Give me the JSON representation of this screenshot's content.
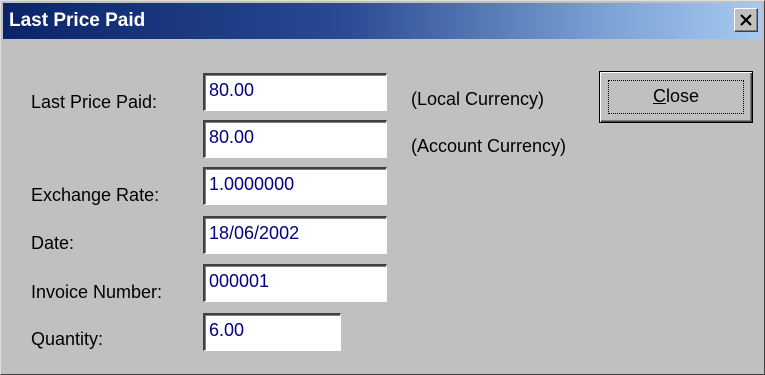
{
  "window": {
    "title": "Last Price Paid"
  },
  "labels": {
    "last_price_paid": "Last Price Paid:",
    "exchange_rate": "Exchange Rate:",
    "date": "Date:",
    "invoice_number": "Invoice Number:",
    "quantity": "Quantity:",
    "local_currency": "(Local Currency)",
    "account_currency": "(Account Currency)"
  },
  "fields": {
    "last_price_local": "80.00",
    "last_price_account": "80.00",
    "exchange_rate": "1.0000000",
    "date": "18/06/2002",
    "invoice_number": "000001",
    "quantity": "6.00"
  },
  "buttons": {
    "close_mnemonic": "C",
    "close_rest": "lose"
  },
  "icons": {
    "titlebar_close": "close-icon"
  },
  "colors": {
    "titlebar_start": "#0a246a",
    "titlebar_end": "#a6caf0",
    "field_text": "#000080",
    "dialog_face": "#c0c0c0"
  }
}
